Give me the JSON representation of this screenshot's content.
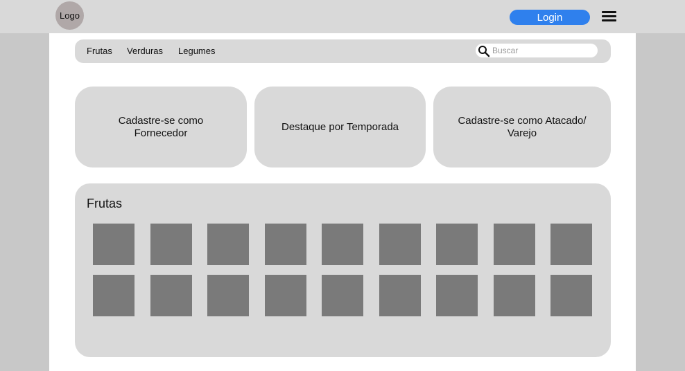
{
  "header": {
    "logo_text": "Logo",
    "login_label": "Login",
    "menu_icon": "hamburger-menu-icon"
  },
  "nav": {
    "links": [
      "Frutas",
      "Verduras",
      "Legumes"
    ],
    "search_placeholder": "Buscar",
    "search_icon": "search-icon"
  },
  "cards": [
    "Cadastre-se como\nFornecedor",
    "Destaque por Temporada",
    "Cadastre-se como Atacado/\nVarejo"
  ],
  "fruits_section": {
    "title": "Frutas",
    "rows": 2,
    "cols": 9
  },
  "colors": {
    "page_bg": "#c8c8c8",
    "topbar_bg": "#d9d9d9",
    "accent": "#2f80ed",
    "placeholder_tile": "#7a7a7a"
  }
}
